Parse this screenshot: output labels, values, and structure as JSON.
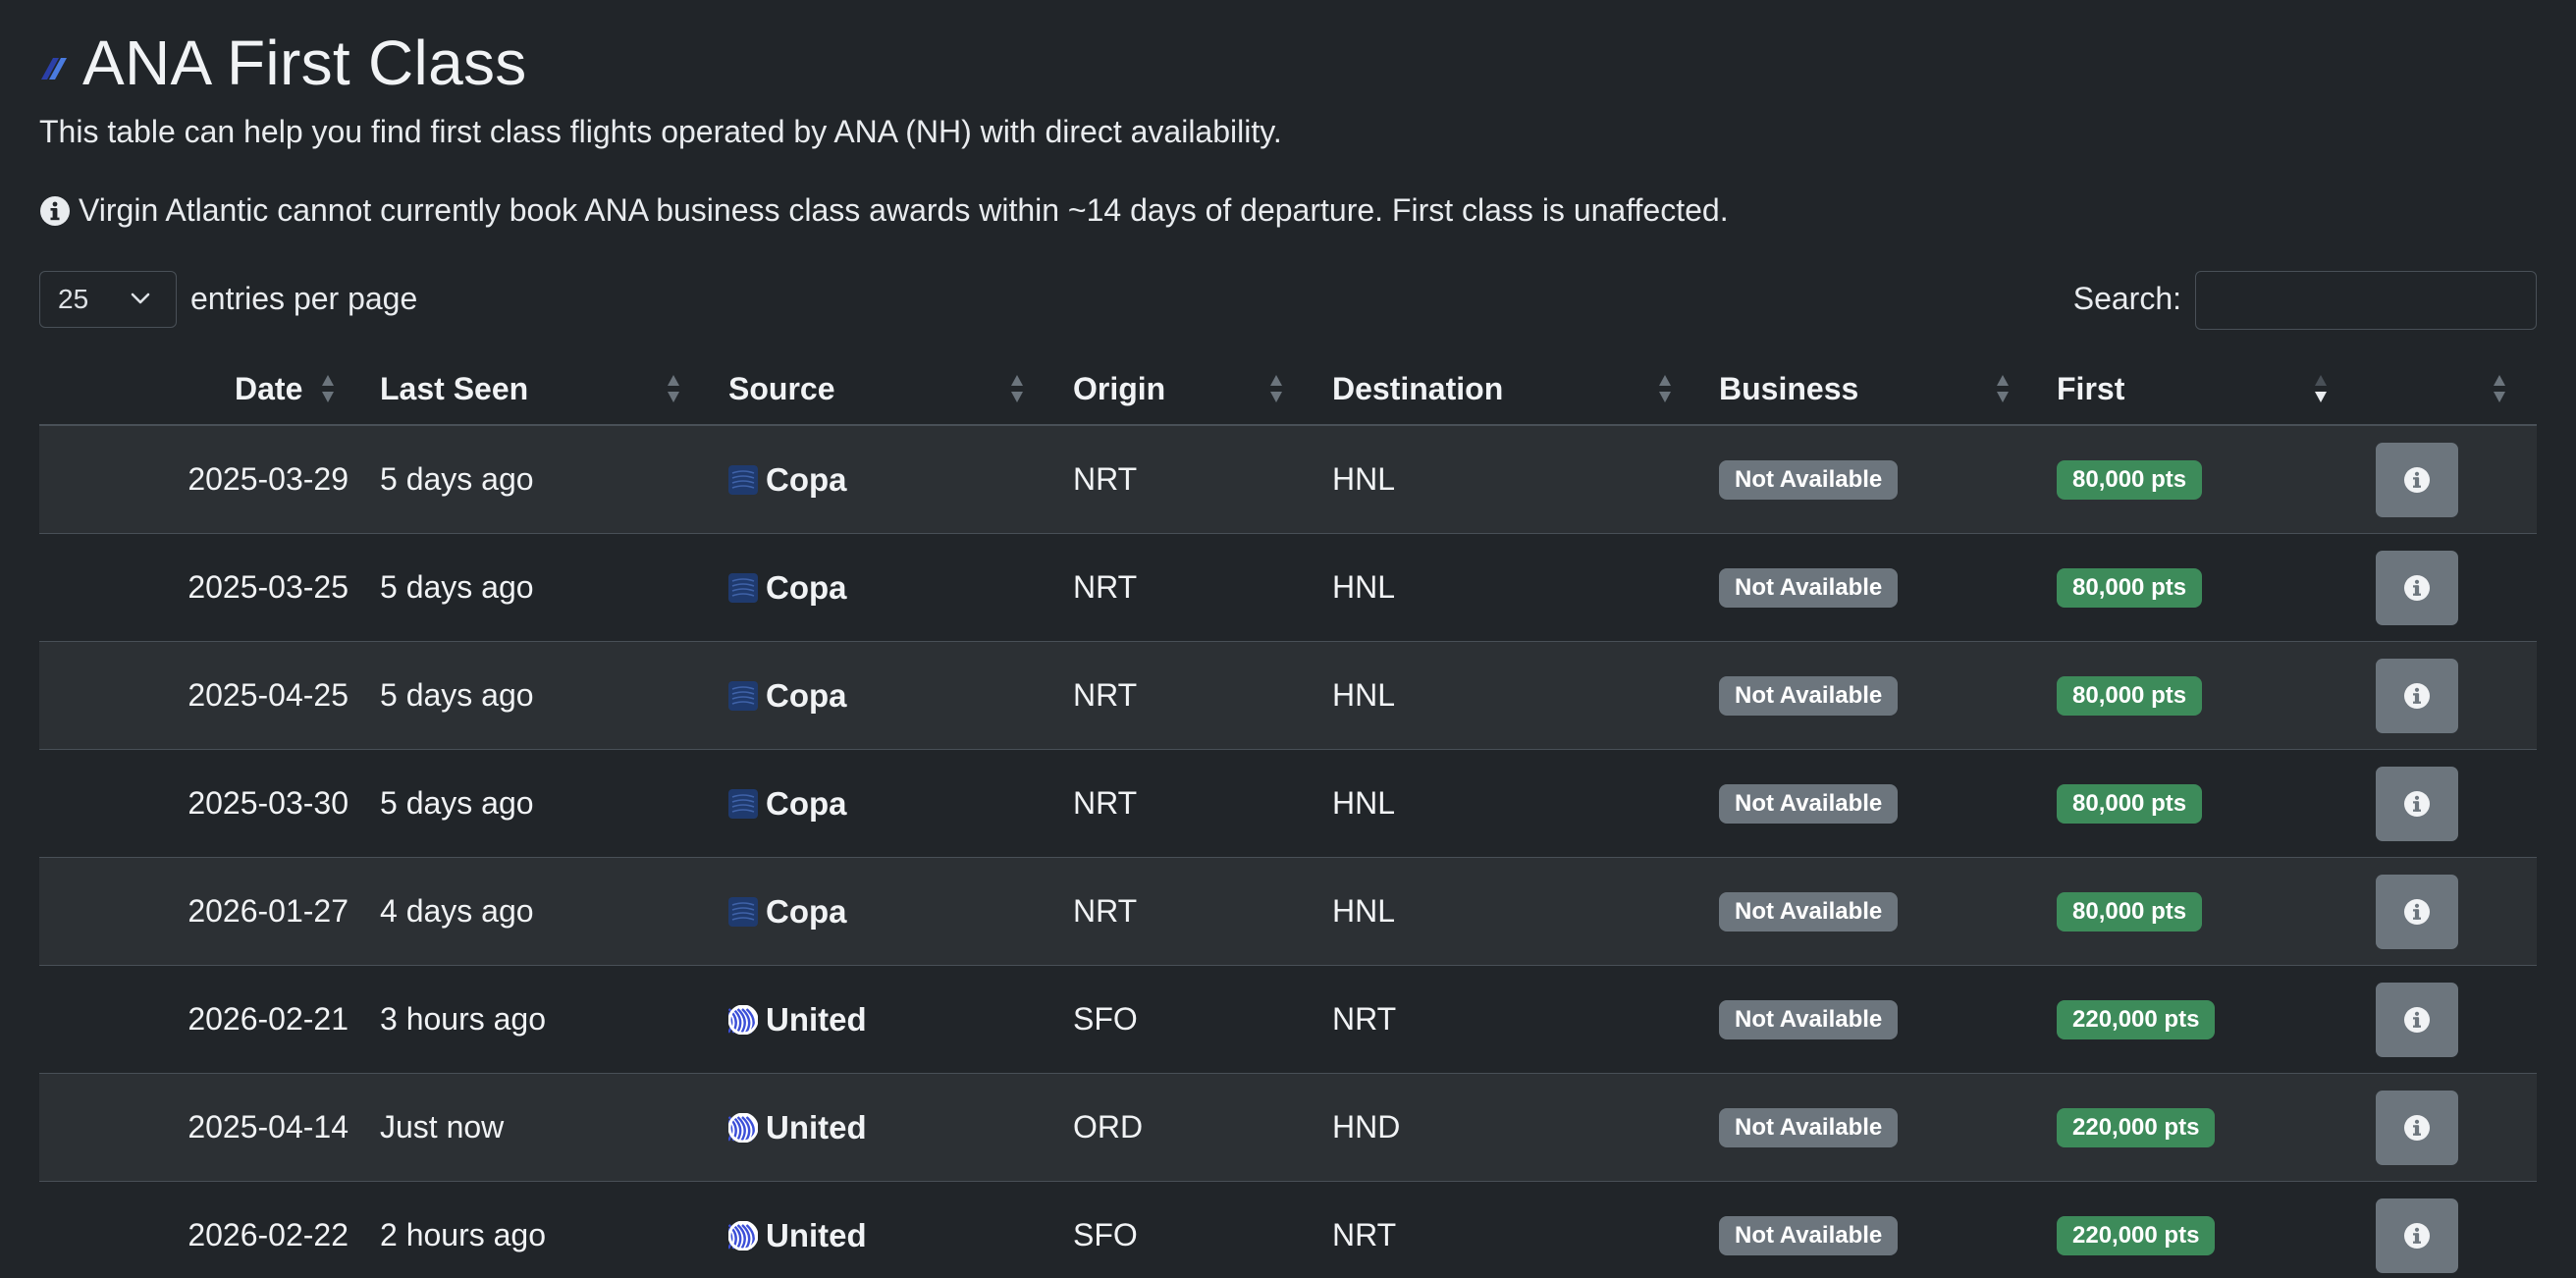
{
  "page": {
    "title": "ANA First Class",
    "description": "This table can help you find first class flights operated by ANA (NH) with direct availability.",
    "notice": "Virgin Atlantic cannot currently book ANA business class awards within ~14 days of departure. First class is unaffected."
  },
  "controls": {
    "page_length": "25",
    "page_length_label": "entries per page",
    "search_label": "Search:",
    "search_value": ""
  },
  "table": {
    "headers": {
      "date": "Date",
      "last_seen": "Last Seen",
      "source": "Source",
      "origin": "Origin",
      "destination": "Destination",
      "business": "Business",
      "first": "First"
    },
    "sorted_column": "First",
    "rows": [
      {
        "date": "2025-03-29",
        "last_seen": "5 days ago",
        "source": "Copa",
        "source_icon": "copa-icon",
        "origin": "NRT",
        "destination": "HNL",
        "business": "Not Available",
        "first": "80,000 pts"
      },
      {
        "date": "2025-03-25",
        "last_seen": "5 days ago",
        "source": "Copa",
        "source_icon": "copa-icon",
        "origin": "NRT",
        "destination": "HNL",
        "business": "Not Available",
        "first": "80,000 pts"
      },
      {
        "date": "2025-04-25",
        "last_seen": "5 days ago",
        "source": "Copa",
        "source_icon": "copa-icon",
        "origin": "NRT",
        "destination": "HNL",
        "business": "Not Available",
        "first": "80,000 pts"
      },
      {
        "date": "2025-03-30",
        "last_seen": "5 days ago",
        "source": "Copa",
        "source_icon": "copa-icon",
        "origin": "NRT",
        "destination": "HNL",
        "business": "Not Available",
        "first": "80,000 pts"
      },
      {
        "date": "2026-01-27",
        "last_seen": "4 days ago",
        "source": "Copa",
        "source_icon": "copa-icon",
        "origin": "NRT",
        "destination": "HNL",
        "business": "Not Available",
        "first": "80,000 pts"
      },
      {
        "date": "2026-02-21",
        "last_seen": "3 hours ago",
        "source": "United",
        "source_icon": "united-globe-icon",
        "origin": "SFO",
        "destination": "NRT",
        "business": "Not Available",
        "first": "220,000 pts"
      },
      {
        "date": "2025-04-14",
        "last_seen": "Just now",
        "source": "United",
        "source_icon": "united-globe-icon",
        "origin": "ORD",
        "destination": "HND",
        "business": "Not Available",
        "first": "220,000 pts"
      },
      {
        "date": "2026-02-22",
        "last_seen": "2 hours ago",
        "source": "United",
        "source_icon": "united-globe-icon",
        "origin": "SFO",
        "destination": "NRT",
        "business": "Not Available",
        "first": "220,000 pts"
      }
    ]
  },
  "colors": {
    "background": "#212529",
    "row_stripe": "#2c3034",
    "badge_not_available": "#6c757d",
    "badge_points": "#3d8b5a",
    "info_button": "#6c757d",
    "copa_blue": "#1f3a6e",
    "united_blue": "#3c4fd8"
  }
}
